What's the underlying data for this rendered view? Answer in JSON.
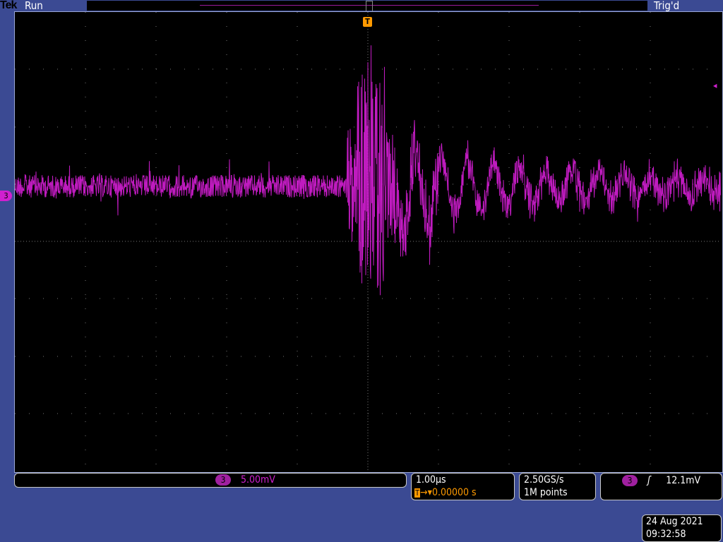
{
  "header": {
    "brand": "Tek",
    "state": "Run",
    "trigger_status": "Trig'd"
  },
  "trigger_marker": "T",
  "channel_marker": "3",
  "vertical": {
    "channel": "3",
    "scale": "5.00mV"
  },
  "horizontal": {
    "scale": "1.00µs",
    "trigger_icon": "T",
    "delay": "0.00000 s"
  },
  "acquisition": {
    "sample_rate": "2.50GS/s",
    "record_length": "1M points"
  },
  "trigger": {
    "channel": "3",
    "slope": "rising",
    "slope_glyph": "ʃ",
    "level": "12.1mV"
  },
  "datetime": {
    "date": "24 Aug 2021",
    "time": "09:32:58"
  },
  "colors": {
    "channel3": "#e020e0",
    "trigger": "#ff9a00",
    "background": "#3b4a93"
  }
}
